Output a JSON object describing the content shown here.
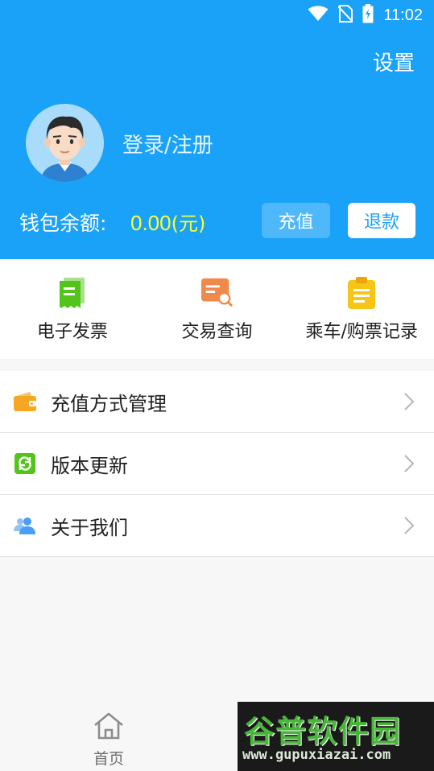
{
  "status_bar": {
    "time": "11:02"
  },
  "header": {
    "settings_label": "设置",
    "login_label": "登录/注册",
    "balance_label": "钱包余额:",
    "balance_amount": "0.00",
    "balance_unit": "(元)",
    "recharge_button": "充值",
    "refund_button": "退款",
    "colors": {
      "background": "#1aa1f8",
      "amount": "#f7ff3a"
    }
  },
  "quick_actions": [
    {
      "label": "电子发票",
      "icon": "e-invoice-icon",
      "color": "#52c41a"
    },
    {
      "label": "交易查询",
      "icon": "transaction-search-icon",
      "color": "#f08a4b"
    },
    {
      "label": "乘车/购票记录",
      "icon": "ride-record-icon",
      "color": "#f5c518"
    }
  ],
  "menu": [
    {
      "label": "充值方式管理",
      "icon": "wallet-icon",
      "color": "#f5a623"
    },
    {
      "label": "版本更新",
      "icon": "refresh-icon",
      "color": "#52c41a"
    },
    {
      "label": "关于我们",
      "icon": "people-icon",
      "color": "#4a9ef5"
    }
  ],
  "bottom_nav": {
    "home_label": "首页"
  },
  "watermark": {
    "title": "谷普软件园",
    "url": "www.gupuxiazai.com"
  }
}
